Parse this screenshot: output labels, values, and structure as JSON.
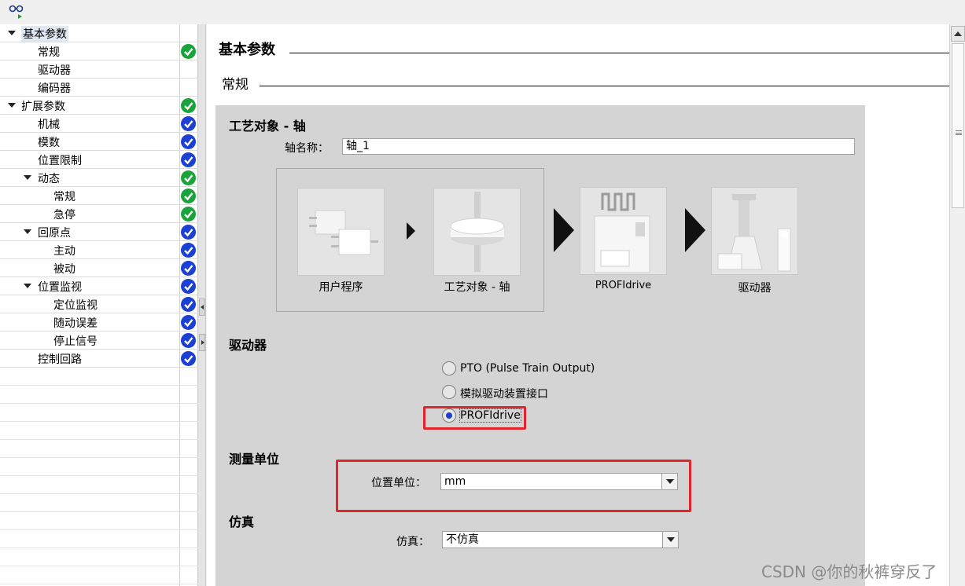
{
  "tree": {
    "items": [
      {
        "label": "基本参数",
        "status": "error",
        "expanded": true,
        "selected": true
      },
      {
        "label": "常规",
        "status": "ok"
      },
      {
        "label": "驱动器",
        "status": "error"
      },
      {
        "label": "编码器",
        "status": "error"
      },
      {
        "label": "扩展参数",
        "status": "ok",
        "expanded": true
      },
      {
        "label": "机械",
        "status": "info"
      },
      {
        "label": "模数",
        "status": "info"
      },
      {
        "label": "位置限制",
        "status": "info"
      },
      {
        "label": "动态",
        "status": "ok",
        "expanded": true
      },
      {
        "label": "常规",
        "status": "ok"
      },
      {
        "label": "急停",
        "status": "ok"
      },
      {
        "label": "回原点",
        "status": "info",
        "expanded": true
      },
      {
        "label": "主动",
        "status": "info"
      },
      {
        "label": "被动",
        "status": "info"
      },
      {
        "label": "位置监视",
        "status": "info",
        "expanded": true
      },
      {
        "label": "定位监视",
        "status": "info"
      },
      {
        "label": "随动误差",
        "status": "info"
      },
      {
        "label": "停止信号",
        "status": "info"
      },
      {
        "label": "控制回路",
        "status": "info"
      }
    ]
  },
  "main": {
    "section_title": "基本参数",
    "subsection_title": "常规",
    "panel_title": "工艺对象 - 轴",
    "axis_name_label": "轴名称：",
    "axis_name_value": "轴_1",
    "flow": {
      "user_program": "用户程序",
      "tech_object": "工艺对象 - 轴",
      "profidrive": "PROFIdrive",
      "drive": "驱动器"
    },
    "drive_group": {
      "title": "驱动器",
      "options": [
        "PTO (Pulse Train Output)",
        "模拟驱动装置接口",
        "PROFIdrive"
      ],
      "selected": "PROFIdrive"
    },
    "units_group": {
      "title": "测量单位",
      "position_unit_label": "位置单位：",
      "position_unit_value": "mm"
    },
    "sim_group": {
      "title": "仿真",
      "sim_label": "仿真：",
      "sim_value": "不仿真"
    }
  },
  "watermark": "CSDN @你的秋裤穿反了",
  "colors": {
    "error": "#e01e28",
    "ok": "#1aa33a",
    "info": "#1c3fd4",
    "highlight": "#e0262c",
    "panel": "#d4d4d4"
  }
}
